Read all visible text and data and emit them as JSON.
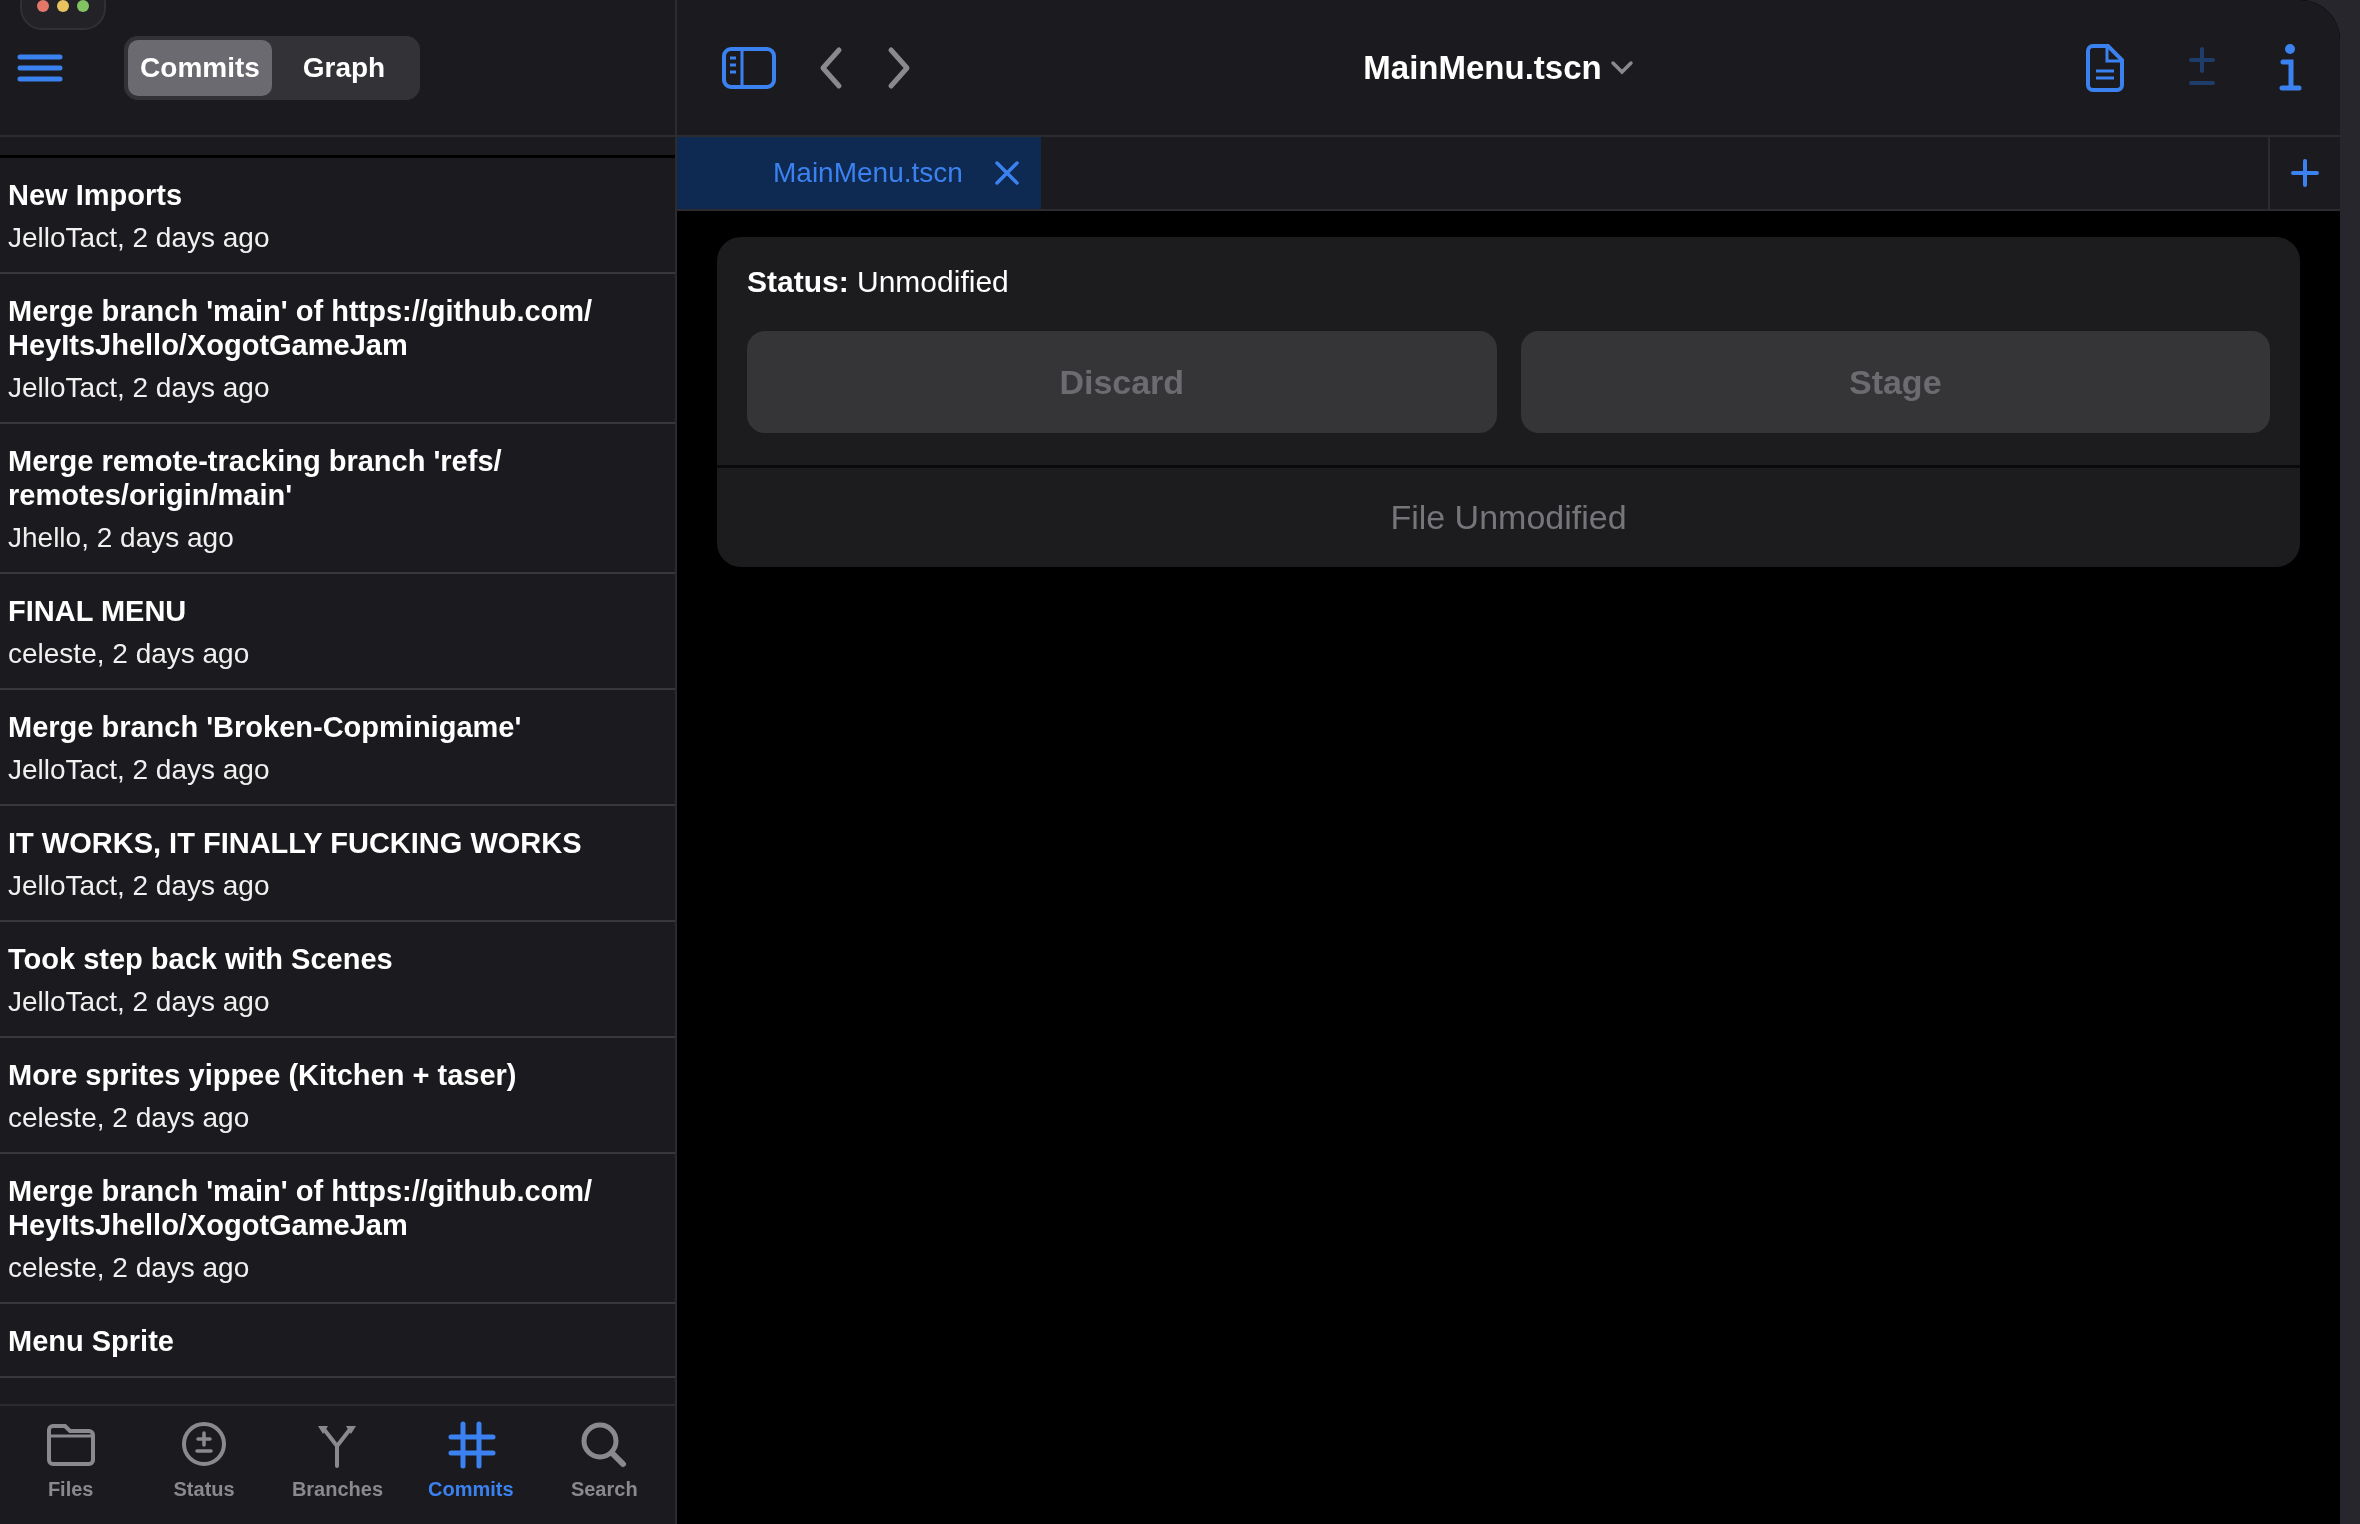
{
  "sidebar": {
    "segments": [
      {
        "label": "Commits",
        "selected": true
      },
      {
        "label": "Graph",
        "selected": false
      }
    ],
    "commits": [
      {
        "message": "New Imports",
        "author": "JelloTact, 2 days ago"
      },
      {
        "message": "Merge branch 'main' of https://github.com/ HeyItsJhello/XogotGameJam",
        "author": "JelloTact, 2 days ago"
      },
      {
        "message": "Merge remote-tracking branch 'refs/ remotes/origin/main'",
        "author": "Jhello, 2 days ago"
      },
      {
        "message": "FINAL MENU",
        "author": "celeste, 2 days ago"
      },
      {
        "message": "Merge branch 'Broken-Copminigame'",
        "author": "JelloTact, 2 days ago"
      },
      {
        "message": "IT WORKS, IT FINALLY FUCKING WORKS",
        "author": "JelloTact, 2 days ago"
      },
      {
        "message": "Took step back with Scenes",
        "author": "JelloTact, 2 days ago"
      },
      {
        "message": "More sprites yippee (Kitchen + taser)",
        "author": "celeste, 2 days ago"
      },
      {
        "message": "Merge branch 'main' of https://github.com/ HeyItsJhello/XogotGameJam",
        "author": "celeste, 2 days ago"
      },
      {
        "message": "Menu Sprite"
      }
    ],
    "tab_bar": [
      {
        "kind": "files",
        "label": "Files",
        "selected": false
      },
      {
        "kind": "status",
        "label": "Status",
        "selected": false
      },
      {
        "kind": "branches",
        "label": "Branches",
        "selected": false
      },
      {
        "kind": "commits",
        "label": "Commits",
        "selected": true
      },
      {
        "kind": "search",
        "label": "Search",
        "selected": false
      }
    ]
  },
  "editor": {
    "title": "MainMenu.tscn",
    "tabs": [
      {
        "label": "MainMenu.tscn",
        "selected": true
      }
    ],
    "status_label": "Status:",
    "status_value": "Unmodified",
    "buttons": [
      {
        "label": "Discard",
        "disabled": true
      },
      {
        "label": "Stage",
        "disabled": true
      }
    ],
    "message": "File Unmodified"
  }
}
